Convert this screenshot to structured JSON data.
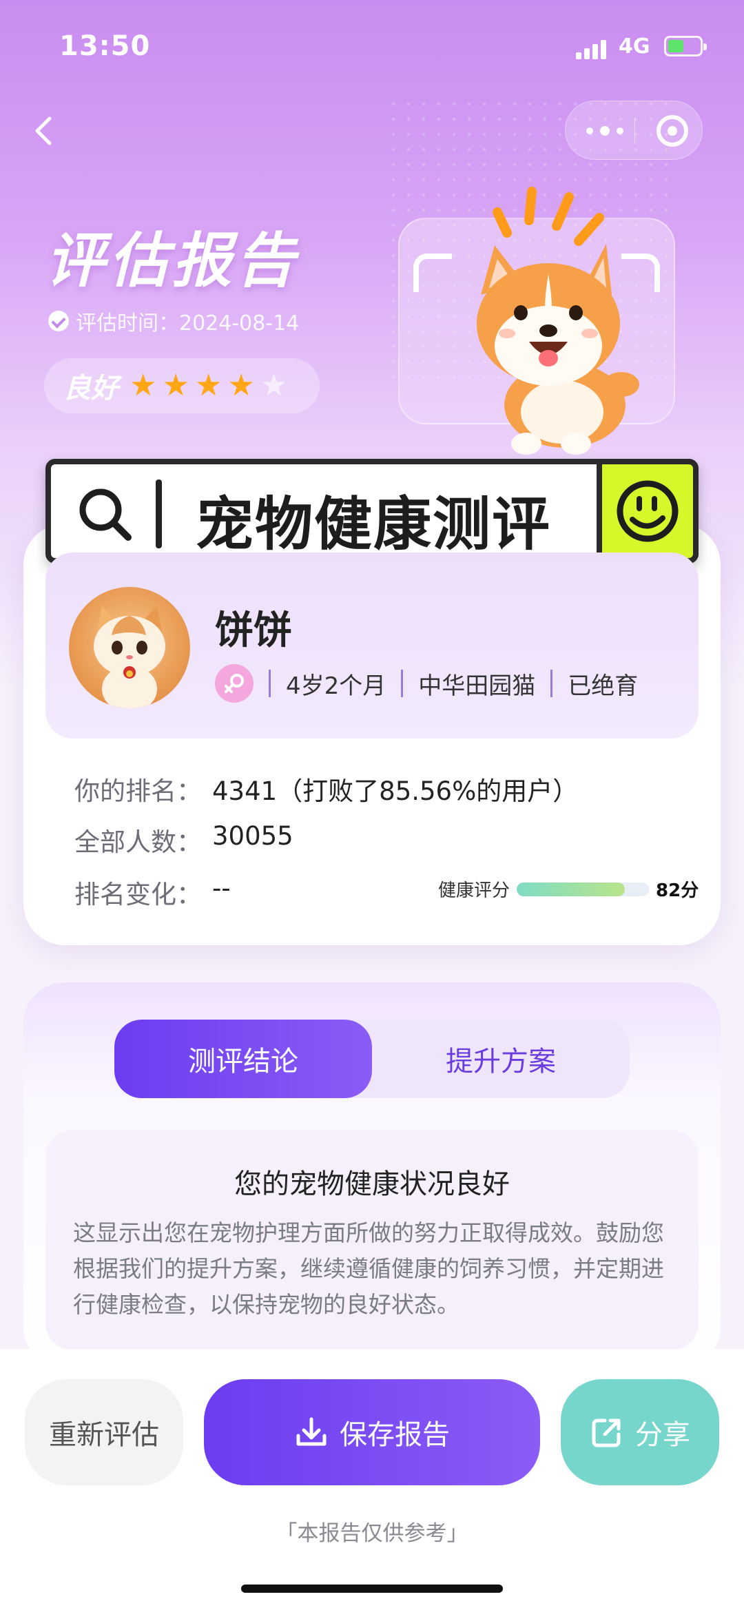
{
  "status_bar": {
    "time": "13:50",
    "network": "4G"
  },
  "header": {
    "title": "评估报告",
    "date_label": "评估时间：2024-08-14",
    "grade": "良好",
    "rating": 4,
    "rating_max": 5
  },
  "search_banner": {
    "text": "宠物健康测评"
  },
  "pet": {
    "name": "饼饼",
    "age": "4岁2个月",
    "breed": "中华田园猫",
    "status": "已绝育"
  },
  "stats": {
    "rank_label": "你的排名：",
    "rank_value": "4341（打败了85.56%的用户）",
    "total_label": "全部人数：",
    "total_value": "30055",
    "change_label": "排名变化：",
    "change_value": "--"
  },
  "health_score": {
    "label": "健康评分",
    "value_text": "82分",
    "value": 82,
    "max": 100
  },
  "tabs": [
    {
      "label": "测评结论",
      "active": true
    },
    {
      "label": "提升方案",
      "active": false
    }
  ],
  "result": {
    "title": "您的宠物健康状况良好",
    "description": "这显示出您在宠物护理方面所做的努力正取得成效。鼓励您根据我们的提升方案，继续遵循健康的饲养习惯，并定期进行健康检查，以保持宠物的良好状态。"
  },
  "actions": {
    "redo": "重新评估",
    "save": "保存报告",
    "share": "分享"
  },
  "footnote": "「本报告仅供参考」",
  "colors": {
    "primary": "#6b3df0",
    "accent_star": "#ffa617",
    "share": "#76d6cc",
    "banner_accent": "#d8f72a"
  }
}
